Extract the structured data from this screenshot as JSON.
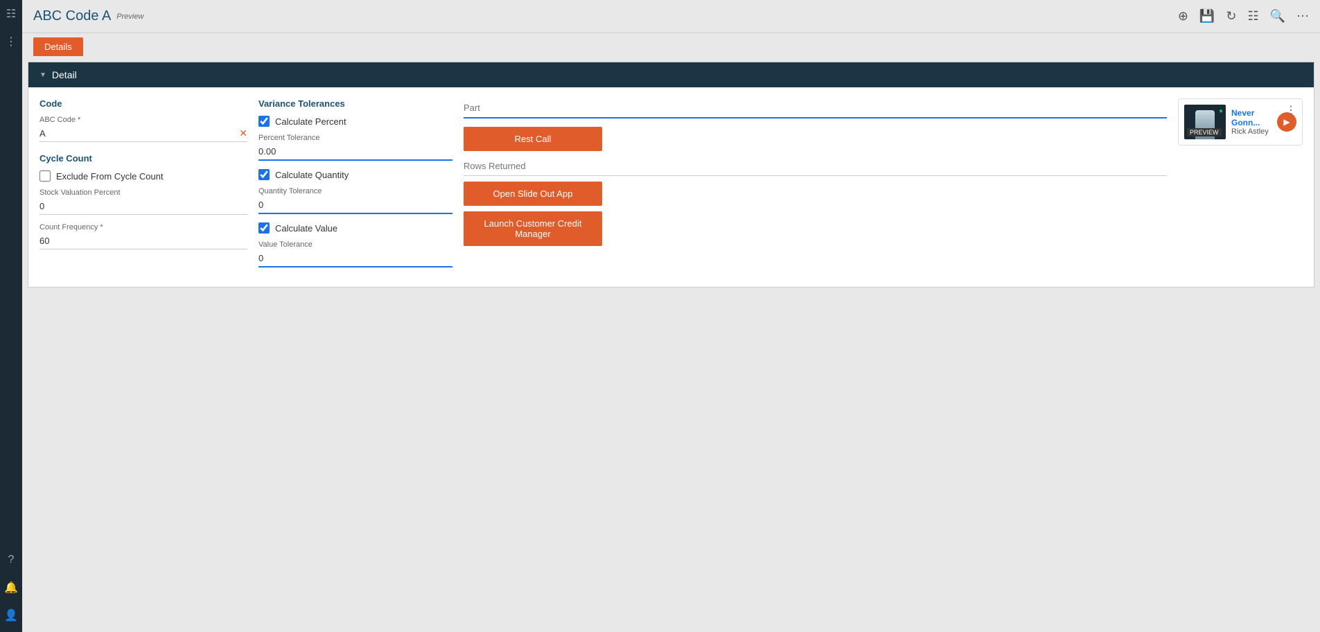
{
  "sidebar": {
    "icons": [
      "grid-icon",
      "apps-icon"
    ],
    "bottom_icons": [
      "help-icon",
      "bell-icon",
      "user-icon"
    ]
  },
  "header": {
    "title": "ABC Code A",
    "preview": "Preview",
    "toolbar_icons": [
      "plus-icon",
      "save-icon",
      "refresh-icon",
      "grid-view-icon",
      "search-icon",
      "more-icon"
    ]
  },
  "tabs": [
    {
      "label": "Details",
      "active": true
    }
  ],
  "detail": {
    "section_title": "Detail",
    "code_section": {
      "title": "Code",
      "abc_code_label": "ABC Code *",
      "abc_code_value": "A"
    },
    "cycle_count_section": {
      "title": "Cycle Count",
      "exclude_label": "Exclude From Cycle Count",
      "exclude_checked": false,
      "stock_valuation_label": "Stock Valuation Percent",
      "stock_valuation_value": "0",
      "count_frequency_label": "Count Frequency *",
      "count_frequency_value": "60"
    },
    "variance_tolerances": {
      "title": "Variance Tolerances",
      "calculate_percent_label": "Calculate Percent",
      "calculate_percent_checked": true,
      "percent_tolerance_label": "Percent Tolerance",
      "percent_tolerance_value": "0.00",
      "calculate_quantity_label": "Calculate Quantity",
      "calculate_quantity_checked": true,
      "quantity_tolerance_label": "Quantity Tolerance",
      "quantity_tolerance_value": "0",
      "calculate_value_label": "Calculate Value",
      "calculate_value_checked": true,
      "value_tolerance_label": "Value Tolerance",
      "value_tolerance_value": "0"
    },
    "actions_section": {
      "part_placeholder": "Part",
      "rest_call_label": "Rest Call",
      "rows_returned_placeholder": "Rows Returned",
      "open_slide_out_label": "Open Slide Out App",
      "launch_credit_manager_label": "Launch Customer Credit Manager"
    },
    "music_widget": {
      "title": "Never Gonn...",
      "artist": "Rick Astley",
      "preview_label": "PREVIEW"
    }
  }
}
